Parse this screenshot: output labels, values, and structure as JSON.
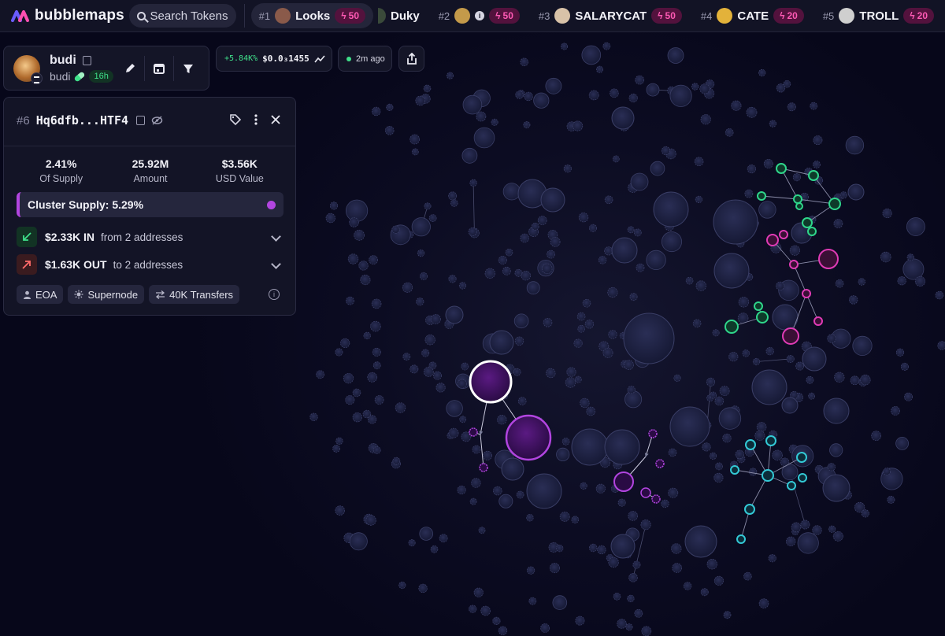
{
  "app": {
    "name": "bubblemaps"
  },
  "search": {
    "label": "Search Tokens"
  },
  "trending": [
    {
      "rank": "#1",
      "name": "Looks",
      "boost": "50",
      "avatar_color": "#8a5a4a",
      "active": true
    },
    {
      "rank": "",
      "name": "Duky",
      "boost": "",
      "avatar_color": "#3a4a3a"
    },
    {
      "rank": "#2",
      "name": "",
      "boost": "50",
      "avatar_color": "#c49a4a",
      "info": true
    },
    {
      "rank": "#3",
      "name": "SALARYCAT",
      "boost": "50",
      "avatar_color": "#d8c2a8"
    },
    {
      "rank": "#4",
      "name": "CATE",
      "boost": "20",
      "avatar_color": "#e3b23a"
    },
    {
      "rank": "#5",
      "name": "TROLL",
      "boost": "20",
      "avatar_color": "#cfcfcf"
    }
  ],
  "token": {
    "name": "budi",
    "symbol": "budi",
    "age": "16h"
  },
  "price": {
    "change": "+5.84K%",
    "value": "$0.0₃1455"
  },
  "updated": {
    "label": "2m ago"
  },
  "wallet": {
    "rank": "#6",
    "address": "Hq6dfb...HTF4",
    "stats": [
      {
        "value": "2.41%",
        "label": "Of Supply"
      },
      {
        "value": "25.92M",
        "label": "Amount"
      },
      {
        "value": "$3.56K",
        "label": "USD Value"
      }
    ],
    "cluster_supply": "Cluster Supply: 5.29%",
    "inflow": {
      "amount": "$2.33K IN",
      "desc": "from 2 addresses"
    },
    "outflow": {
      "amount": "$1.63K OUT",
      "desc": "to 2 addresses"
    },
    "tags": [
      "EOA",
      "Supernode",
      "40K Transfers"
    ]
  },
  "colors": {
    "accent_purple": "#b245e0",
    "green_cluster": "#2fd68b",
    "magenta_cluster": "#e03bb5",
    "cyan_cluster": "#33c9d6",
    "node": "#1e2140"
  }
}
